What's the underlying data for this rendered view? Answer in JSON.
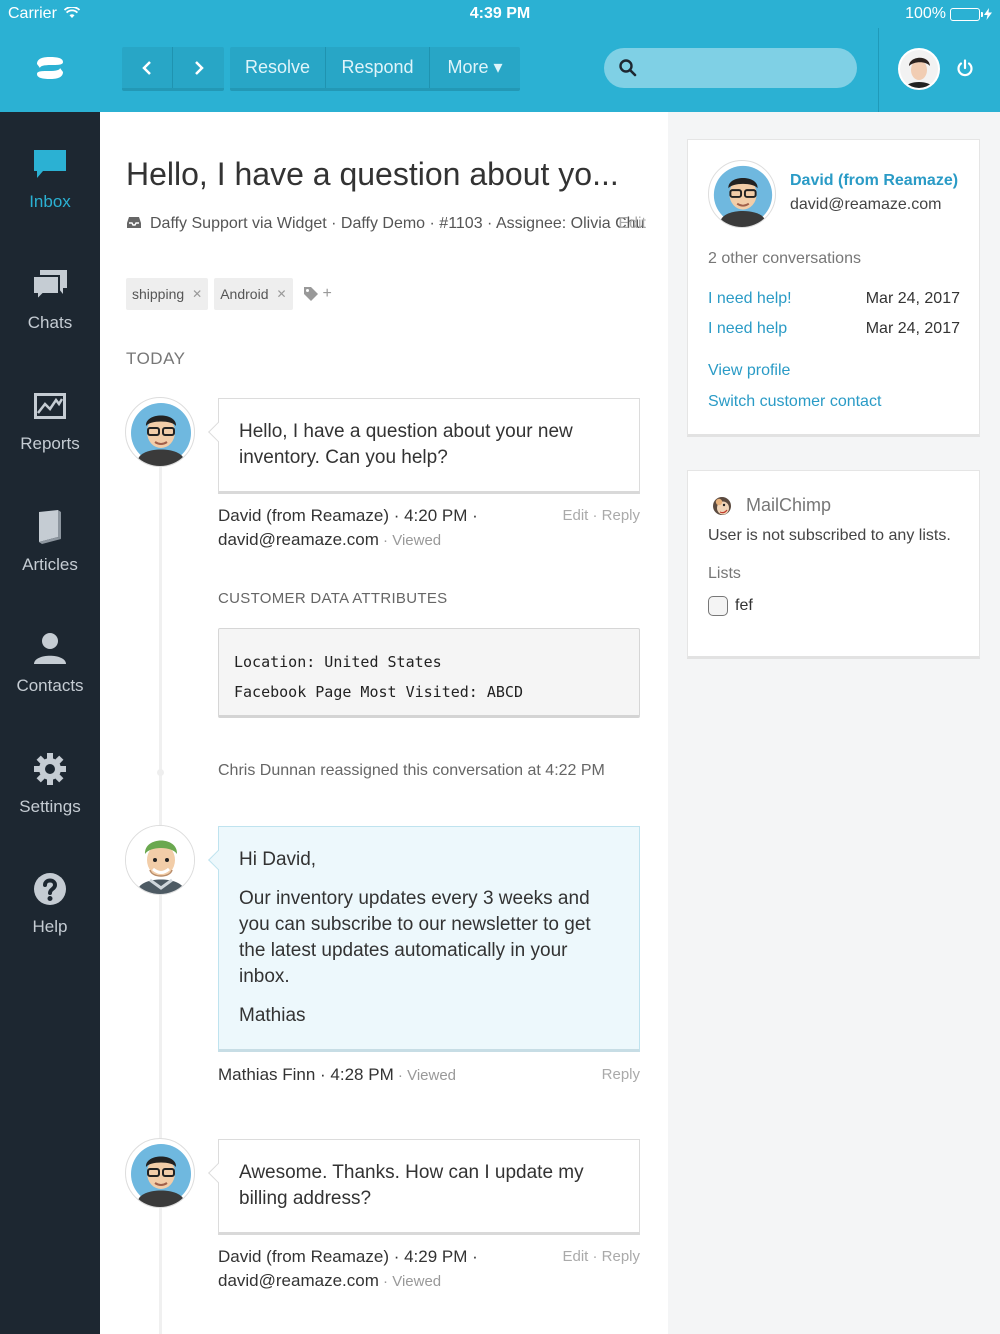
{
  "status_bar": {
    "carrier": "Carrier",
    "time": "4:39 PM",
    "battery": "100%"
  },
  "toolbar": {
    "prev": "‹",
    "next": "›",
    "resolve": "Resolve",
    "respond": "Respond",
    "more": "More ▾",
    "search_placeholder": ""
  },
  "sidebar": {
    "items": [
      {
        "label": "Inbox",
        "icon": "chat-bubble-icon",
        "active": true
      },
      {
        "label": "Chats",
        "icon": "chats-icon"
      },
      {
        "label": "Reports",
        "icon": "chart-icon"
      },
      {
        "label": "Articles",
        "icon": "book-icon"
      },
      {
        "label": "Contacts",
        "icon": "person-icon"
      },
      {
        "label": "Settings",
        "icon": "gear-icon"
      },
      {
        "label": "Help",
        "icon": "question-icon"
      }
    ]
  },
  "conversation": {
    "title": "Hello, I have a question about yo...",
    "meta_line": "Daffy Support via Widget · Daffy Demo · #1103 · Assignee: Olivia Chu",
    "edit": "Edit",
    "tags": [
      "shipping",
      "Android"
    ],
    "tag_add": "+",
    "today": "TODAY",
    "messages": [
      {
        "body": "Hello, I have a question about your new inventory. Can you help?",
        "author": "David (from Reamaze) · 4:20 PM ·",
        "email": "david@reamaze.com",
        "viewed": " · Viewed",
        "actions": "Edit  ·  Reply"
      },
      {
        "greeting": "Hi David,",
        "body": "Our inventory updates every 3 weeks and you can subscribe to our newsletter to get the latest updates automatically in your inbox.",
        "signature": "Mathias",
        "author": "Mathias Finn · 4:28 PM",
        "viewed": " · Viewed",
        "actions": "Reply"
      },
      {
        "body": "Awesome. Thanks. How can I update my billing address?",
        "author": "David (from Reamaze) · 4:29 PM ·",
        "email": "david@reamaze.com",
        "viewed": " · Viewed",
        "actions": "Edit  ·  Reply"
      }
    ],
    "cda_label": "CUSTOMER DATA ATTRIBUTES",
    "cda_line1": "Location: United States",
    "cda_line2": "Facebook Page Most Visited: ABCD",
    "system_note": "Chris Dunnan reassigned this conversation at 4:22 PM"
  },
  "customer": {
    "name": "David (from Reamaze)",
    "email": "david@reamaze.com",
    "other_conversations": "2 other conversations",
    "conversations": [
      {
        "label": "I need help!",
        "date": "Mar 24, 2017"
      },
      {
        "label": "I need help",
        "date": "Mar 24, 2017"
      }
    ],
    "view_profile": "View profile",
    "switch_contact": "Switch customer contact"
  },
  "mailchimp": {
    "title": "MailChimp",
    "status": "User is not subscribed to any lists.",
    "lists_label": "Lists",
    "list_item": "fef"
  },
  "colors": {
    "brand": "#2bb1d3",
    "sidebar": "#1d2731",
    "link": "#2a9bc6"
  }
}
